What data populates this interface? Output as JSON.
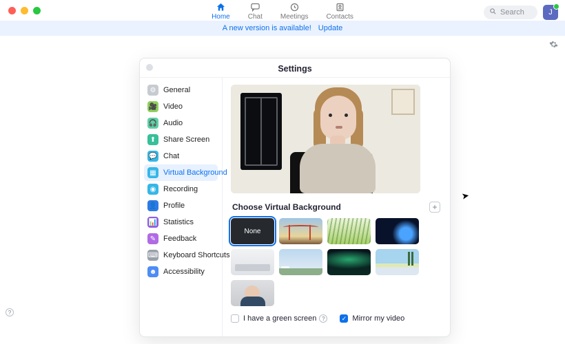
{
  "nav": {
    "items": [
      {
        "label": "Home",
        "icon": "home-icon",
        "active": true
      },
      {
        "label": "Chat",
        "icon": "chat-icon",
        "active": false
      },
      {
        "label": "Meetings",
        "icon": "clock-icon",
        "active": false
      },
      {
        "label": "Contacts",
        "icon": "contacts-icon",
        "active": false
      }
    ]
  },
  "search": {
    "placeholder": "Search"
  },
  "user": {
    "initial": "J"
  },
  "banner": {
    "text": "A new version is available!",
    "link": "Update"
  },
  "modal": {
    "title": "Settings",
    "sidebar": {
      "items": [
        {
          "label": "General",
          "icon": "gear-icon",
          "color": "#c7cbd1"
        },
        {
          "label": "Video",
          "icon": "video-icon",
          "color": "#8fd15b"
        },
        {
          "label": "Audio",
          "icon": "headphones-icon",
          "color": "#5bd1a5"
        },
        {
          "label": "Share Screen",
          "icon": "share-screen-icon",
          "color": "#37c09a"
        },
        {
          "label": "Chat",
          "icon": "chat-icon",
          "color": "#35b7e8"
        },
        {
          "label": "Virtual Background",
          "icon": "virtual-bg-icon",
          "color": "#35b7e8",
          "active": true
        },
        {
          "label": "Recording",
          "icon": "recording-icon",
          "color": "#35b7e8"
        },
        {
          "label": "Profile",
          "icon": "profile-icon",
          "color": "#2f7ae5"
        },
        {
          "label": "Statistics",
          "icon": "statistics-icon",
          "color": "#8e5be0"
        },
        {
          "label": "Feedback",
          "icon": "feedback-icon",
          "color": "#b06be4"
        },
        {
          "label": "Keyboard Shortcuts",
          "icon": "keyboard-icon",
          "color": "#9aa0aa"
        },
        {
          "label": "Accessibility",
          "icon": "accessibility-icon",
          "color": "#4f8cf5"
        }
      ]
    },
    "content": {
      "section_title": "Choose Virtual Background",
      "thumbs": [
        {
          "label": "None",
          "type": "none",
          "selected": true
        },
        {
          "label": "",
          "type": "bridge"
        },
        {
          "label": "",
          "type": "grass"
        },
        {
          "label": "",
          "type": "earth"
        },
        {
          "label": "",
          "type": "office"
        },
        {
          "label": "",
          "type": "sky",
          "video": true
        },
        {
          "label": "",
          "type": "aur"
        },
        {
          "label": "",
          "type": "beach"
        },
        {
          "label": "",
          "type": "selfie"
        }
      ],
      "green_screen": {
        "label": "I have a green screen",
        "checked": false
      },
      "mirror": {
        "label": "Mirror my video",
        "checked": true
      }
    }
  }
}
